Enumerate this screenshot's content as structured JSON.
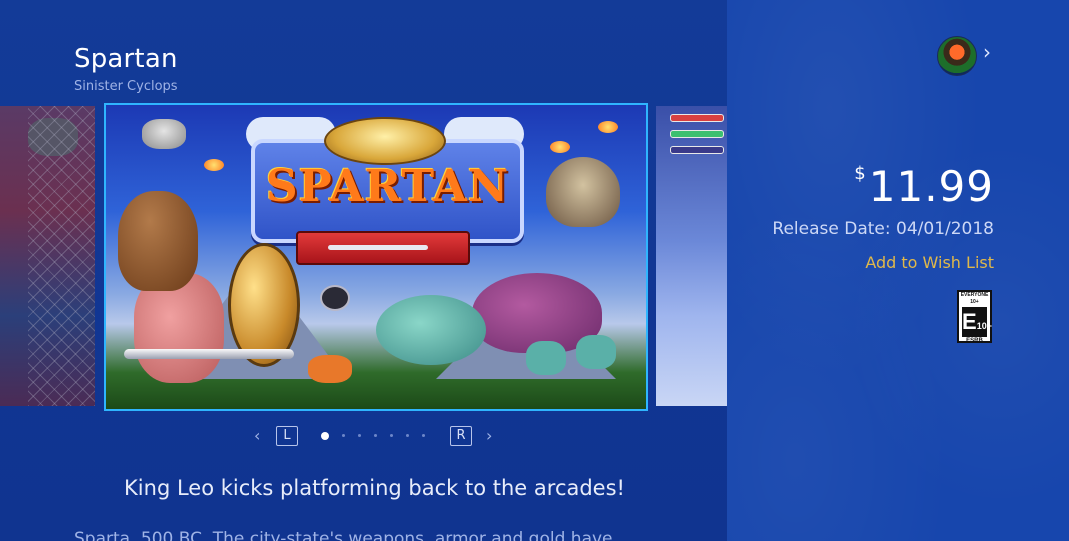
{
  "game": {
    "title": "Spartan",
    "publisher": "Sinister Cyclops"
  },
  "gallery": {
    "logo_text": "SPARTAN",
    "prev_key": "L",
    "next_key": "R",
    "prev_icon": "chevron-left-icon",
    "next_icon": "chevron-right-icon",
    "page_count": 7,
    "current_page": 1
  },
  "tagline": "King Leo kicks platforming back to the arcades!",
  "description": "Sparta, 500 BC. The city-state's weapons, armor and gold have",
  "store": {
    "currency_symbol": "$",
    "price": "11.99",
    "release_date": "Release Date: 04/01/2018",
    "wishlist_label": "Add to Wish List",
    "user_icon": "user-avatar-icon",
    "user_chevron": "chevron-right-icon"
  },
  "rating": {
    "top_text": "EVERYONE 10+",
    "letter": "E",
    "sub": "10+",
    "board": "ESRB"
  },
  "colors": {
    "background": "#123a95",
    "info_panel": "#1746ad",
    "selection_border": "#2fb5ff",
    "wishlist": "#e0b84a"
  }
}
